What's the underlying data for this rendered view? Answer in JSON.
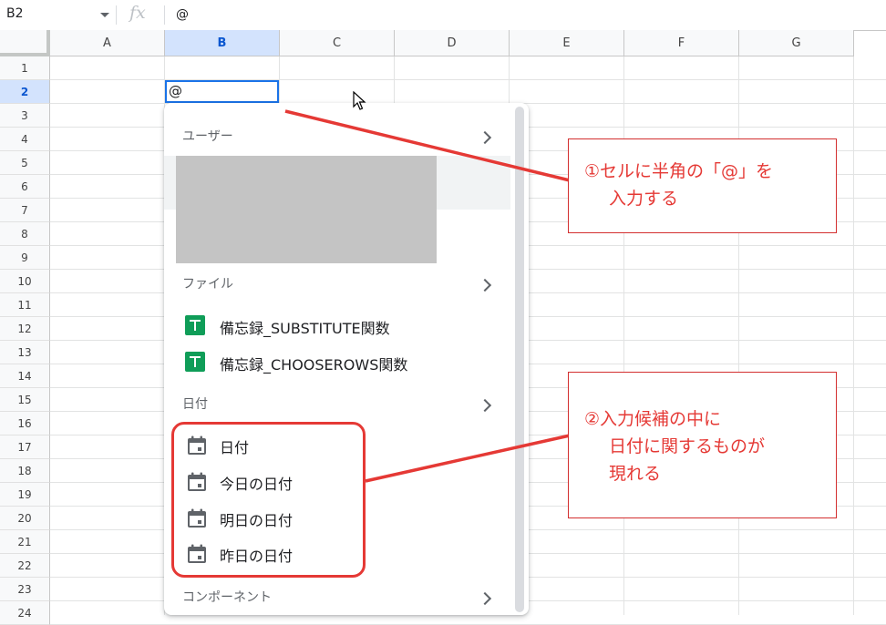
{
  "formula_bar": {
    "cell_reference": "B2",
    "fx_symbol": "fx",
    "formula": "@"
  },
  "grid": {
    "columns": [
      "A",
      "B",
      "C",
      "D",
      "E",
      "F",
      "G"
    ],
    "rows": [
      "1",
      "2",
      "3",
      "4",
      "5",
      "6",
      "7",
      "8",
      "9",
      "10",
      "11",
      "12",
      "13",
      "14",
      "15",
      "16",
      "17",
      "18",
      "19",
      "20",
      "21",
      "22",
      "23",
      "24"
    ],
    "active_cell_value": "@"
  },
  "dropdown": {
    "users_label": "ユーザー",
    "files_label": "ファイル",
    "files": [
      "備忘録_SUBSTITUTE関数",
      "備忘録_CHOOSEROWS関数"
    ],
    "dates_label": "日付",
    "dates": [
      "日付",
      "今日の日付",
      "明日の日付",
      "昨日の日付"
    ],
    "components_label": "コンポーネント"
  },
  "annotations": {
    "note1": {
      "line1": "①セルに半角の「@」を",
      "line2": "入力する"
    },
    "note2": {
      "line1": "②入力候補の中に",
      "line2": "日付に関するものが",
      "line3": "現れる"
    }
  },
  "colors": {
    "annotation_red": "#e53935",
    "sheets_green": "#0f9d58",
    "selection_blue": "#1a73e8"
  },
  "icons": [
    "chevron-right-icon",
    "google-sheets-icon",
    "calendar-icon",
    "mouse-pointer-icon",
    "dropdown-arrow-icon",
    "fx-icon"
  ]
}
